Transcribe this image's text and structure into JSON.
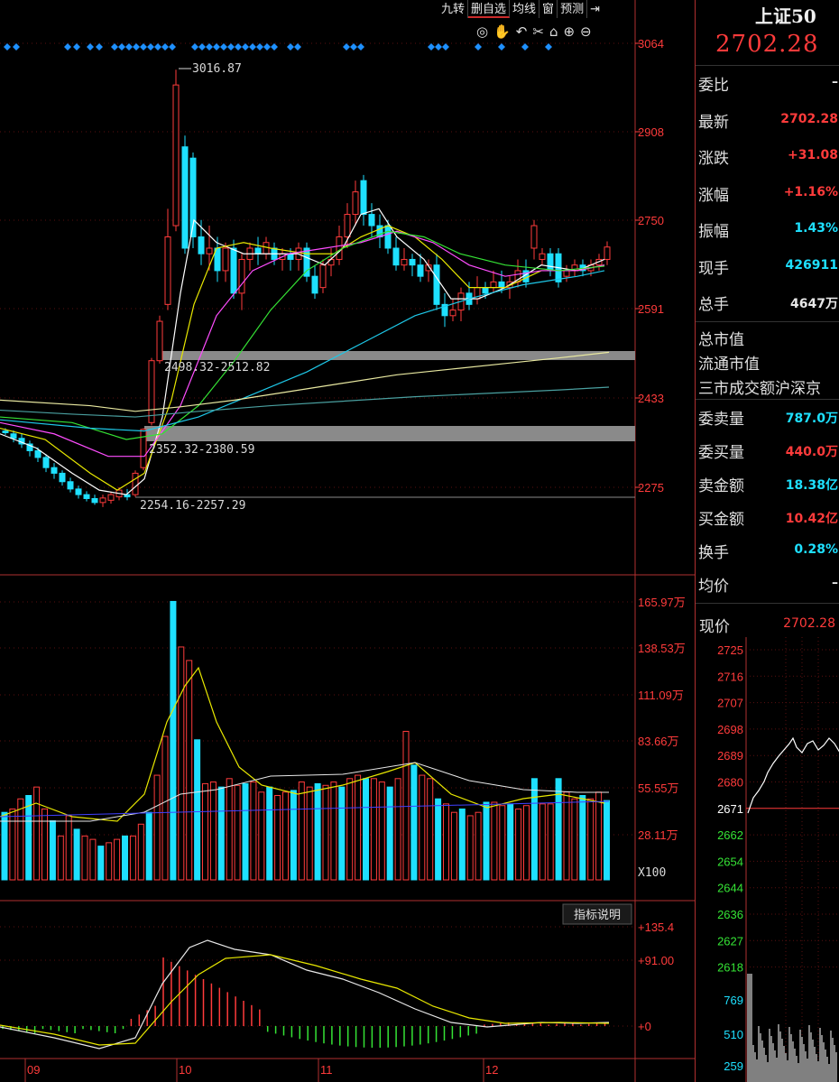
{
  "toolbar": {
    "buttons": [
      "九转",
      "删自选",
      "均线",
      "窗",
      "预测"
    ],
    "icons": [
      "eye-icon",
      "hand-icon",
      "undo-icon",
      "scissors-icon",
      "lock-icon",
      "zoom-in-icon",
      "zoom-out-icon",
      "collapse-panel-icon"
    ]
  },
  "colors": {
    "up": "#ff3b3b",
    "down": "#1ee0ff",
    "axis": "#ff3b3b",
    "grid": "#5a1010",
    "ma5": "#ffffff",
    "ma10": "#e8e800",
    "ma20": "#ff4dff",
    "ma30": "#35e335",
    "ma60": "#1ec8e8",
    "ma120": "#e8e8a0",
    "ma250": "#4aa0a0"
  },
  "kline": {
    "y_axis": [
      "3064",
      "2908",
      "2750",
      "2591",
      "2433",
      "2275"
    ],
    "max_label": "3016.87",
    "gap_labels": [
      "2498.32-2512.82",
      "2352.32-2380.59",
      "2254.16-2257.29"
    ]
  },
  "volume": {
    "y_axis": [
      "165.97万",
      "138.53万",
      "111.09万",
      "83.66万",
      "55.55万",
      "28.11万"
    ],
    "unit": "X100"
  },
  "macd": {
    "button": "指标说明",
    "y_axis": [
      "+135.4",
      "+91.00",
      "+0"
    ]
  },
  "x_axis": [
    "09",
    "10",
    "11",
    "12"
  ],
  "chart_data": {
    "type": "candlestick",
    "x_months": [
      "09",
      "10",
      "11",
      "12"
    ],
    "price_axis": [
      2275,
      2433,
      2591,
      2750,
      2908,
      3064
    ],
    "high_marked": 3016.87,
    "close_last": 2702.28,
    "gaps": [
      [
        2498.32,
        2512.82
      ],
      [
        2352.32,
        2380.59
      ],
      [
        2254.16,
        2257.29
      ]
    ],
    "volume_axis_wan": [
      28.11,
      55.55,
      83.66,
      111.09,
      138.53,
      165.97
    ],
    "macd_axis": [
      0,
      91.0,
      135.4
    ]
  },
  "panel": {
    "name": "上证50",
    "price": "2702.28",
    "rows1": [
      {
        "label": "委比",
        "value": "–",
        "color": "white"
      },
      {
        "label": "最新",
        "value": "2702.28",
        "color": "red"
      },
      {
        "label": "涨跌",
        "value": "+31.08",
        "color": "red"
      },
      {
        "label": "涨幅",
        "value": "+1.16%",
        "color": "red"
      },
      {
        "label": "振幅",
        "value": "1.43%",
        "color": "cyan"
      },
      {
        "label": "现手",
        "value": "426911",
        "color": "cyan"
      },
      {
        "label": "总手",
        "value": "4647万",
        "color": "white"
      }
    ],
    "rows2": [
      "总市值",
      "流通市值",
      "三市成交额沪深京"
    ],
    "rows3": [
      {
        "label": "委卖量",
        "value": "787.0万",
        "color": "cyan"
      },
      {
        "label": "委买量",
        "value": "440.0万",
        "color": "red"
      },
      {
        "label": "卖金额",
        "value": "18.38亿",
        "color": "cyan"
      },
      {
        "label": "买金额",
        "value": "10.42亿",
        "color": "red"
      },
      {
        "label": "换手",
        "value": "0.28%",
        "color": "cyan"
      },
      {
        "label": "均价",
        "value": "–",
        "color": "white"
      }
    ],
    "now_label": "现价",
    "now_value": "2702.28",
    "mini_y": [
      "2725",
      "2716",
      "2707",
      "2698",
      "2689",
      "2680",
      "2671",
      "2662",
      "2654",
      "2644",
      "2636",
      "2627",
      "2618"
    ],
    "mini_vol": [
      "769",
      "510",
      "259"
    ]
  }
}
